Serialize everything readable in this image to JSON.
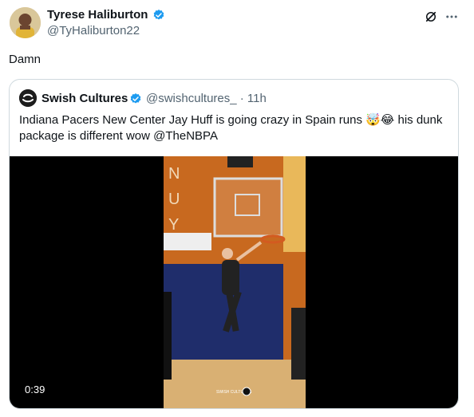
{
  "tweet": {
    "author_name": "Tyrese Haliburton",
    "author_handle": "@TyHaliburton22",
    "text": "Damn",
    "top_icons": [
      "grok-icon",
      "more-icon"
    ]
  },
  "quoted": {
    "name": "Swish Cultures",
    "meta": "@swishcultures_ · 11h",
    "text_part1": "Indiana Pacers New Center Jay Huff is going crazy in Spain runs ",
    "emoji": "🤯😂",
    "text_part2": " his dunk package is different wow @TheNBPA",
    "video": {
      "duration": "0:39",
      "wall_letters": "NUY",
      "watermark": "SWISH CULTURES"
    }
  },
  "colors": {
    "verified": "#1d9bf0",
    "secondary_text": "#536471",
    "border": "#cfd9de",
    "court_orange": "#d9792b",
    "court_blue": "#1f2d6b"
  }
}
